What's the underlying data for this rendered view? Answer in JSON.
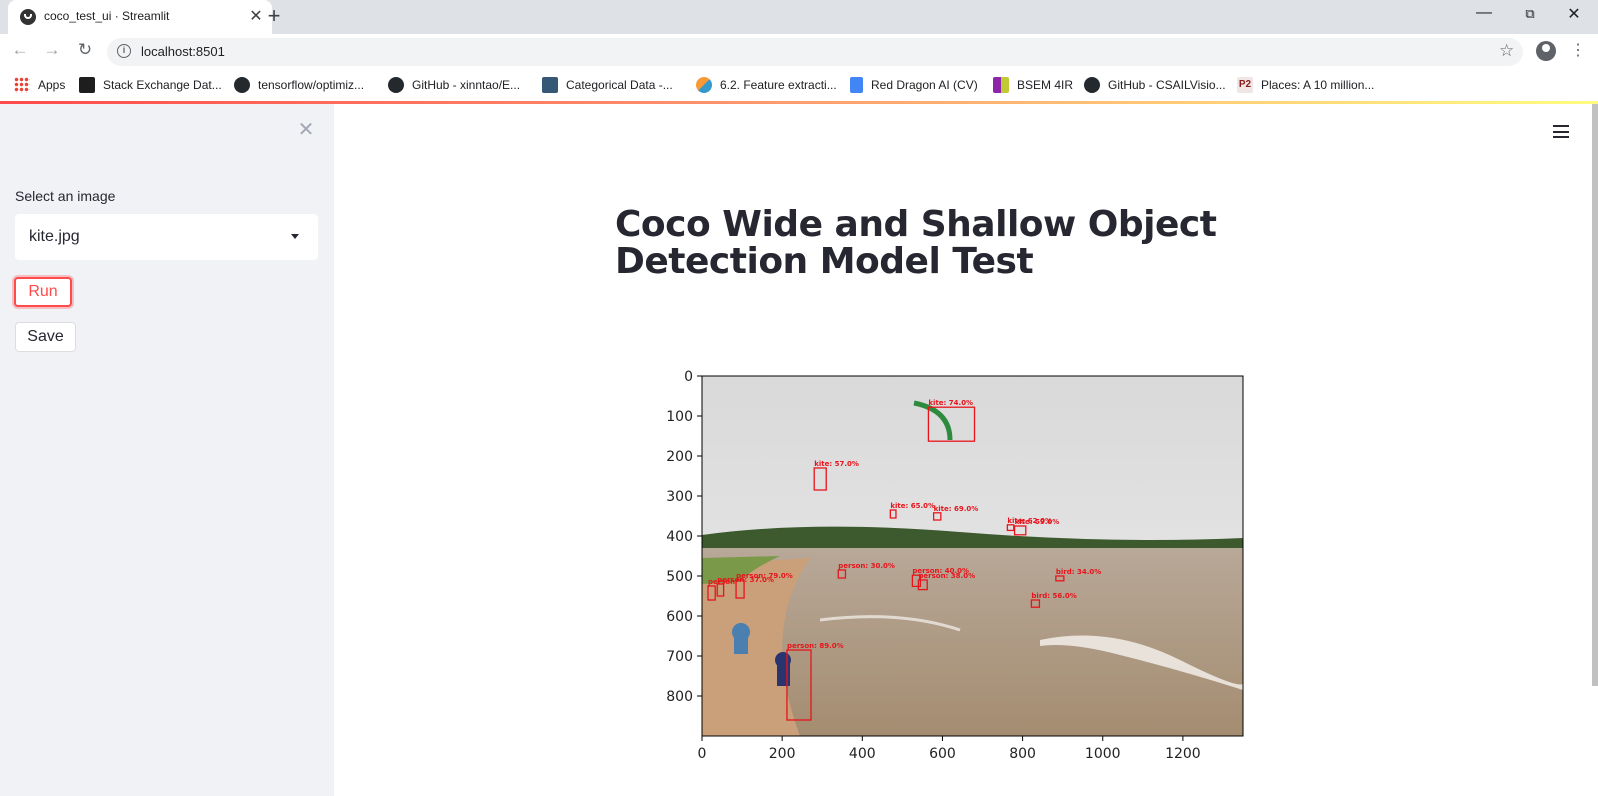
{
  "browser": {
    "tab_title": "coco_test_ui · Streamlit",
    "url": "localhost:8501",
    "bookmarks": [
      {
        "label": "Apps",
        "icon": "apps-grid-icon",
        "color": "#4285f4"
      },
      {
        "label": "Stack Exchange Dat...",
        "icon": "stack-exchange-icon",
        "color": "#1e1e1e"
      },
      {
        "label": "tensorflow/optimiz...",
        "icon": "github-icon",
        "color": "#24292e"
      },
      {
        "label": "GitHub - xinntao/E...",
        "icon": "github-icon",
        "color": "#24292e"
      },
      {
        "label": "Categorical Data -...",
        "icon": "tds-icon",
        "color": "#355876"
      },
      {
        "label": "6.2. Feature extracti...",
        "icon": "sklearn-icon",
        "color": "#f89939"
      },
      {
        "label": "Red Dragon AI (CV)",
        "icon": "google-docs-icon",
        "color": "#4285f4"
      },
      {
        "label": "BSEM 4IR",
        "icon": "bsem-icon",
        "color": "#8e24aa"
      },
      {
        "label": "GitHub - CSAILVisio...",
        "icon": "github-icon",
        "color": "#24292e"
      },
      {
        "label": "Places: A 10 million...",
        "icon": "p2-icon",
        "color": "#8b1a1a"
      }
    ]
  },
  "sidebar": {
    "select_label": "Select an image",
    "selected_image": "kite.jpg",
    "run_label": "Run",
    "save_label": "Save"
  },
  "main": {
    "title": "Coco Wide and Shallow Object Detection Model Test"
  },
  "chart_data": {
    "type": "image",
    "xlim": [
      0,
      1350
    ],
    "ylim": [
      900,
      0
    ],
    "x_ticks": [
      0,
      200,
      400,
      600,
      800,
      1000,
      1200
    ],
    "y_ticks": [
      0,
      100,
      200,
      300,
      400,
      500,
      600,
      700,
      800
    ],
    "detections": [
      {
        "label": "kite: 74.0%",
        "x": 565,
        "y": 78,
        "w": 115,
        "h": 85
      },
      {
        "label": "kite: 57.0%",
        "x": 280,
        "y": 230,
        "w": 30,
        "h": 55
      },
      {
        "label": "kite: 65.0%",
        "x": 470,
        "y": 335,
        "w": 14,
        "h": 20
      },
      {
        "label": "kite: 69.0%",
        "x": 578,
        "y": 342,
        "w": 18,
        "h": 18
      },
      {
        "label": "kite: 62.0%",
        "x": 762,
        "y": 372,
        "w": 16,
        "h": 14
      },
      {
        "label": "kite: 59.0%",
        "x": 780,
        "y": 375,
        "w": 28,
        "h": 22
      },
      {
        "label": "person: 30.0%",
        "x": 340,
        "y": 485,
        "w": 18,
        "h": 20
      },
      {
        "label": "person: 40.0%",
        "x": 525,
        "y": 498,
        "w": 20,
        "h": 28
      },
      {
        "label": "person: 38.0%",
        "x": 540,
        "y": 510,
        "w": 22,
        "h": 24
      },
      {
        "label": "bird: 34.0%",
        "x": 883,
        "y": 500,
        "w": 20,
        "h": 12
      },
      {
        "label": "bird: 56.0%",
        "x": 822,
        "y": 560,
        "w": 20,
        "h": 18
      },
      {
        "label": "person: 79.0%",
        "x": 85,
        "y": 510,
        "w": 20,
        "h": 45
      },
      {
        "label": "person: 37.0%",
        "x": 38,
        "y": 520,
        "w": 16,
        "h": 30
      },
      {
        "label": "person",
        "x": 15,
        "y": 525,
        "w": 18,
        "h": 35
      },
      {
        "label": "person: 89.0%",
        "x": 212,
        "y": 685,
        "w": 60,
        "h": 175
      }
    ]
  }
}
